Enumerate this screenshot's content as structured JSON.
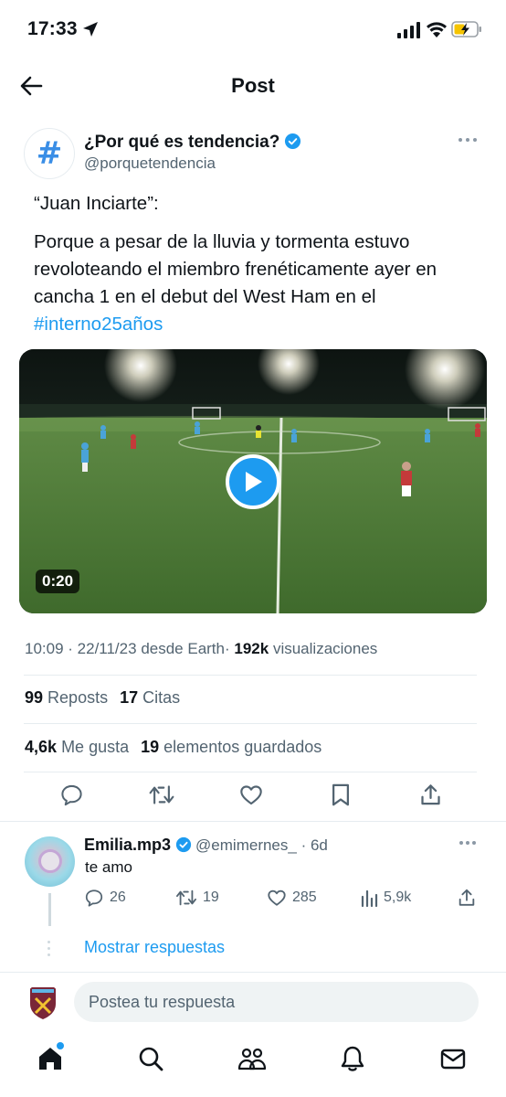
{
  "status_bar": {
    "time": "17:33"
  },
  "header": {
    "title": "Post"
  },
  "post": {
    "author_avatar_glyph": "#",
    "author_name": "¿Por qué es tendencia?",
    "author_handle": "@porquetendencia",
    "quote": "“Juan Inciarte”:",
    "body": "Porque a pesar de la lluvia y tormenta estuvo revoloteando el miembro frenéticamente ayer en cancha 1 en el debut del West Ham en el",
    "hashtag": "#interno25años",
    "video_duration": "0:20",
    "time": "10:09",
    "date": "22/11/23",
    "source": "desde Earth",
    "views_count": "192k",
    "views_label": "visualizaciones",
    "reposts_count": "99",
    "reposts_label": "Reposts",
    "quotes_count": "17",
    "quotes_label": "Citas",
    "likes_count": "4,6k",
    "likes_label": "Me gusta",
    "bookmarks_count": "19",
    "bookmarks_label": "elementos guardados"
  },
  "reply": {
    "name": "Emilia.mp3",
    "handle": "@emimernes_",
    "age": "6d",
    "text": "te amo",
    "replies": "26",
    "reposts": "19",
    "likes": "285",
    "views": "5,9k",
    "show_replies": "Mostrar respuestas"
  },
  "composer": {
    "placeholder": "Postea tu respuesta"
  },
  "colors": {
    "accent": "#1d9bf0",
    "text": "#0f1419",
    "muted": "#536471",
    "divider": "#e6ecf0"
  }
}
